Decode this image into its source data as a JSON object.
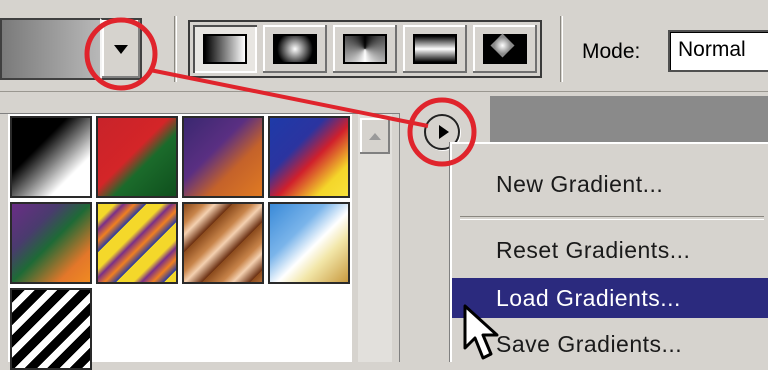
{
  "options_bar": {
    "mode_label": "Mode:",
    "mode_value": "Normal",
    "gradient_types": [
      "linear",
      "radial",
      "angle",
      "reflected",
      "diamond"
    ],
    "active_type": "linear"
  },
  "swatches": [
    {
      "name": "foreground-to-background",
      "css": "linear-gradient(135deg,#000 0%,#000 35%,#fff 75%,#fff 100%)"
    },
    {
      "name": "red-green",
      "css": "linear-gradient(135deg,#c8232a 0%,#d42528 45%,#1b6b2b 60%,#0f4f1d 100%)"
    },
    {
      "name": "violet-orange",
      "css": "linear-gradient(135deg,#3a2870 0%,#5a2f82 40%,#c4622a 65%,#e07a22 100%)"
    },
    {
      "name": "blue-red-yellow",
      "css": "linear-gradient(135deg,#1e3aa8 0%,#2b34a0 35%,#d0202c 55%,#f4d62a 80%,#f8e23a 100%)"
    },
    {
      "name": "violet-green-orange",
      "css": "linear-gradient(135deg,#6a2d86 0%,#4a3b6e 30%,#1e6a36 50%,#e3772a 80%,#f08a22 100%)"
    },
    {
      "name": "yellow-violet-orange-blue",
      "css": "repeating-linear-gradient(135deg,#f4d82a 0px,#f4d82a 12px,#7a2f88 18px,#f08020 26px,#2a3aa0 34px)"
    },
    {
      "name": "copper",
      "css": "repeating-linear-gradient(135deg,#8a4a1c 0px,#c8844a 14px,#f4d0b0 22px,#6a2e10 34px)"
    },
    {
      "name": "chrome",
      "css": "linear-gradient(135deg,#3a8ad8 0%,#7ab4ea 35%,#ffffff 55%,#f2e6a8 70%,#c89a40 100%)"
    },
    {
      "name": "transparent-stripes",
      "css": "repeating-linear-gradient(135deg,#000 0px,#000 9px,#ffffff 9px,#ffffff 16px)"
    }
  ],
  "menu": {
    "items": [
      {
        "label": "New Gradient...",
        "highlighted": false
      },
      {
        "label": "Reset Gradients...",
        "highlighted": false
      },
      {
        "label": "Load Gradients...",
        "highlighted": true
      },
      {
        "label": "Save Gradients...",
        "highlighted": false
      }
    ]
  },
  "colors": {
    "ui_gray": "#d6d3ce",
    "highlight": "#2b2a7e",
    "annotation_red": "#e0242c"
  },
  "icons": {
    "picker_arrow": "chevron-down-icon",
    "menu_button": "play-circle-icon",
    "scroll_up": "scroll-up-arrow-icon",
    "cursor": "mouse-pointer-icon"
  }
}
